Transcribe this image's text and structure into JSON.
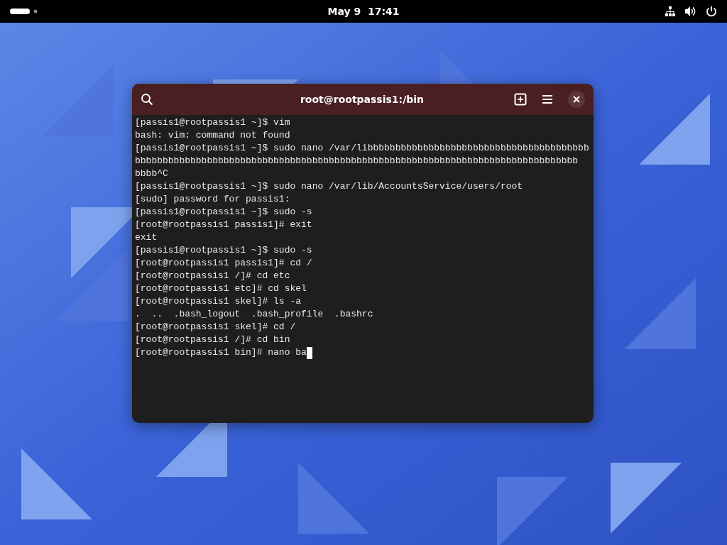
{
  "top_bar": {
    "clock": "May 9  17:41"
  },
  "terminal_window": {
    "title": "root@rootpassis1:/bin",
    "lines": [
      "[passis1@rootpassis1 ~]$ vim",
      "bash: vim: command not found",
      "[passis1@rootpassis1 ~]$ sudo nano /var/libbbbbbbbbbbbbbbbbbbbbbbbbbbbbbbbbbbbbbbb",
      "bbbbbbbbbbbbbbbbbbbbbbbbbbbbbbbbbbbbbbbbbbbbbbbbbbbbbbbbbbbbbbbbbbbbbbbbbbbbbbbb",
      "bbbb^C",
      "[passis1@rootpassis1 ~]$ sudo nano /var/lib/AccountsService/users/root",
      "[sudo] password for passis1:",
      "[passis1@rootpassis1 ~]$ sudo -s",
      "[root@rootpassis1 passis1]# exit",
      "exit",
      "[passis1@rootpassis1 ~]$ sudo -s",
      "[root@rootpassis1 passis1]# cd /",
      "[root@rootpassis1 /]# cd etc",
      "[root@rootpassis1 etc]# cd skel",
      "[root@rootpassis1 skel]# ls -a",
      ".  ..  .bash_logout  .bash_profile  .bashrc",
      "[root@rootpassis1 skel]# cd /",
      "[root@rootpassis1 /]# cd bin",
      "[root@rootpassis1 bin]# nano ba"
    ],
    "cursor_visible": true
  }
}
